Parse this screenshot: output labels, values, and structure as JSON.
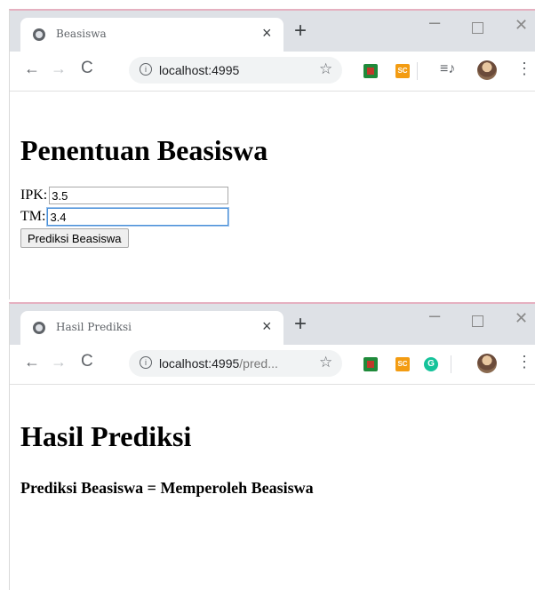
{
  "window1": {
    "tab_title": "Beasiswa",
    "url": "localhost:4995",
    "heading": "Penentuan Beasiswa",
    "form": {
      "ipk_label": "IPK:",
      "ipk_value": "3.5",
      "tm_label": "TM:",
      "tm_value": "3.4",
      "submit_label": "Prediksi Beasiswa"
    }
  },
  "window2": {
    "tab_title": "Hasil Prediksi",
    "url_host": "localhost:4995",
    "url_rest": "/pred...",
    "heading": "Hasil Prediksi",
    "result_text": "Prediksi Beasiswa = Memperoleh Beasiswa"
  },
  "icons": {
    "back": "back-arrow-icon",
    "forward": "forward-arrow-icon",
    "reload": "reload-icon",
    "info": "info-icon",
    "star": "bookmark-star-icon",
    "menu": "kebab-menu-icon"
  },
  "colors": {
    "tabstrip": "#dee1e6",
    "omnibox": "#f1f3f4",
    "focus_border": "#4a90d9"
  }
}
